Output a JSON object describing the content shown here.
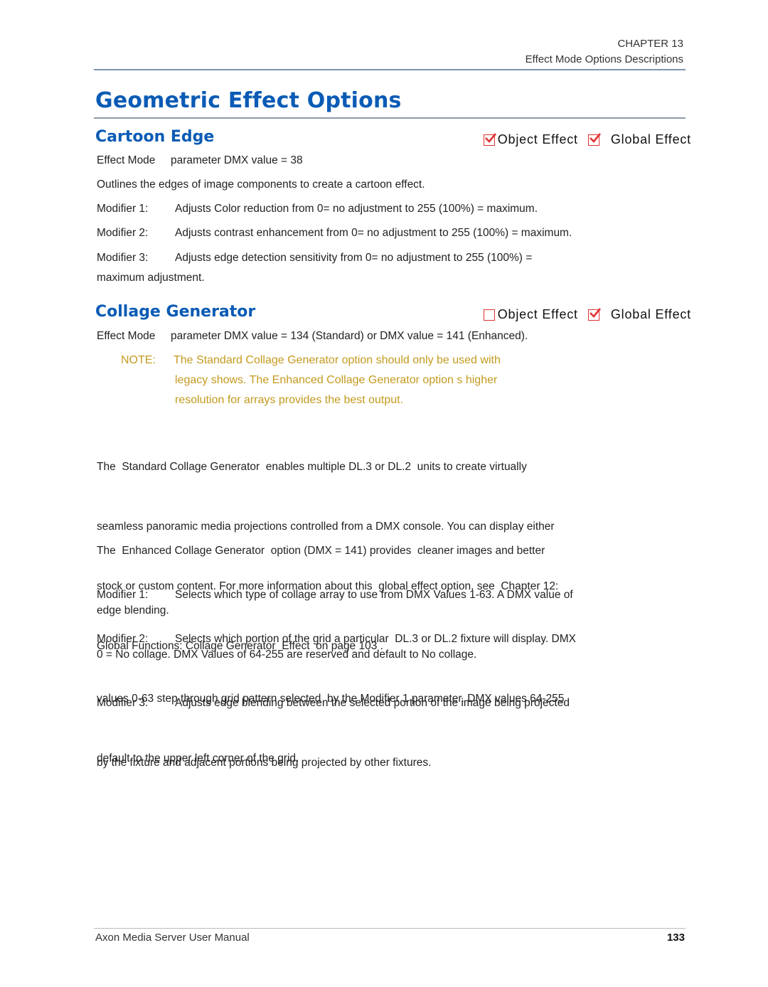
{
  "header": {
    "chapter": "CHAPTER 13",
    "section": "Effect Mode Options Descriptions"
  },
  "title": "Geometric Effect Options",
  "sections": [
    {
      "heading": "Cartoon Edge",
      "flags": {
        "object_label": "Object Effect",
        "object_checked": true,
        "global_label": "Global Effect",
        "global_checked": true
      },
      "effect_mode": "Effect Mode     parameter DMX value = 38",
      "description": "Outlines the edges of image components to create a cartoon effect.",
      "modifiers": [
        {
          "label": "Modifier 1:",
          "text": "Adjusts Color reduction from 0= no adjustment to 255 (100%) = maximum."
        },
        {
          "label": "Modifier 2:",
          "text": "Adjusts contrast enhancement from 0= no adjustment to 255 (100%) = maximum."
        },
        {
          "label": "Modifier 3:",
          "text": "Adjusts edge detection sensitivity from 0= no adjustment to 255 (100%) =",
          "cont": "maximum adjustment."
        }
      ]
    },
    {
      "heading": "Collage Generator",
      "flags": {
        "object_label": "Object Effect",
        "object_checked": false,
        "global_label": "Global Effect",
        "global_checked": true
      },
      "effect_mode": "Effect Mode     parameter DMX value = 134 (Standard) or DMX value = 141 (Enhanced).",
      "note": {
        "label": "NOTE:",
        "line1": "The Standard Collage Generator option should only be used with",
        "line2": "legacy shows. The Enhanced Collage Generator option s higher",
        "line3": "resolution for arrays provides the best output."
      },
      "paragraphs": [
        {
          "lines": [
            "The  Standard Collage Generator  enables multiple DL.3 or DL.2  units to create virtually",
            "seamless panoramic media projections controlled from a DMX console. You can display either",
            "stock or custom content. For more information about this  global effect option, see  Chapter 12:",
            "Global Functions: Collage Generator  Effect  on page 103 ."
          ]
        },
        {
          "lines": [
            "The  Enhanced Collage Generator  option (DMX = 141) provides  cleaner images and better",
            "edge blending."
          ]
        }
      ],
      "modifiers": [
        {
          "label": "Modifier 1:",
          "text": "Selects which type of collage array to use from DMX Values 1-63. A DMX value of",
          "cont": [
            "0 = No collage. DMX Values of 64-255 are reserved and default to No collage."
          ]
        },
        {
          "label": "Modifier 2:",
          "text": "Selects which portion of the grid a particular  DL.3 or DL.2 fixture will display. DMX",
          "cont": [
            "values 0-63 step through grid pattern selected  by the Modifier 1 parameter. DMX values 64-255",
            "default to the upper left corner of the grid."
          ]
        },
        {
          "label": "Modifier 3:",
          "text": "Adjusts edge blending between the selected portion of the image being projected",
          "cont": [
            "by the fixture and adjacent portions being projected by other fixtures."
          ]
        }
      ]
    }
  ],
  "footer": {
    "manual_title": "Axon Media Server User Manual",
    "page_number": "133"
  },
  "colors": {
    "heading": "#0a5bb5",
    "note": "#c49a1f",
    "checkbox": "#e23030"
  }
}
